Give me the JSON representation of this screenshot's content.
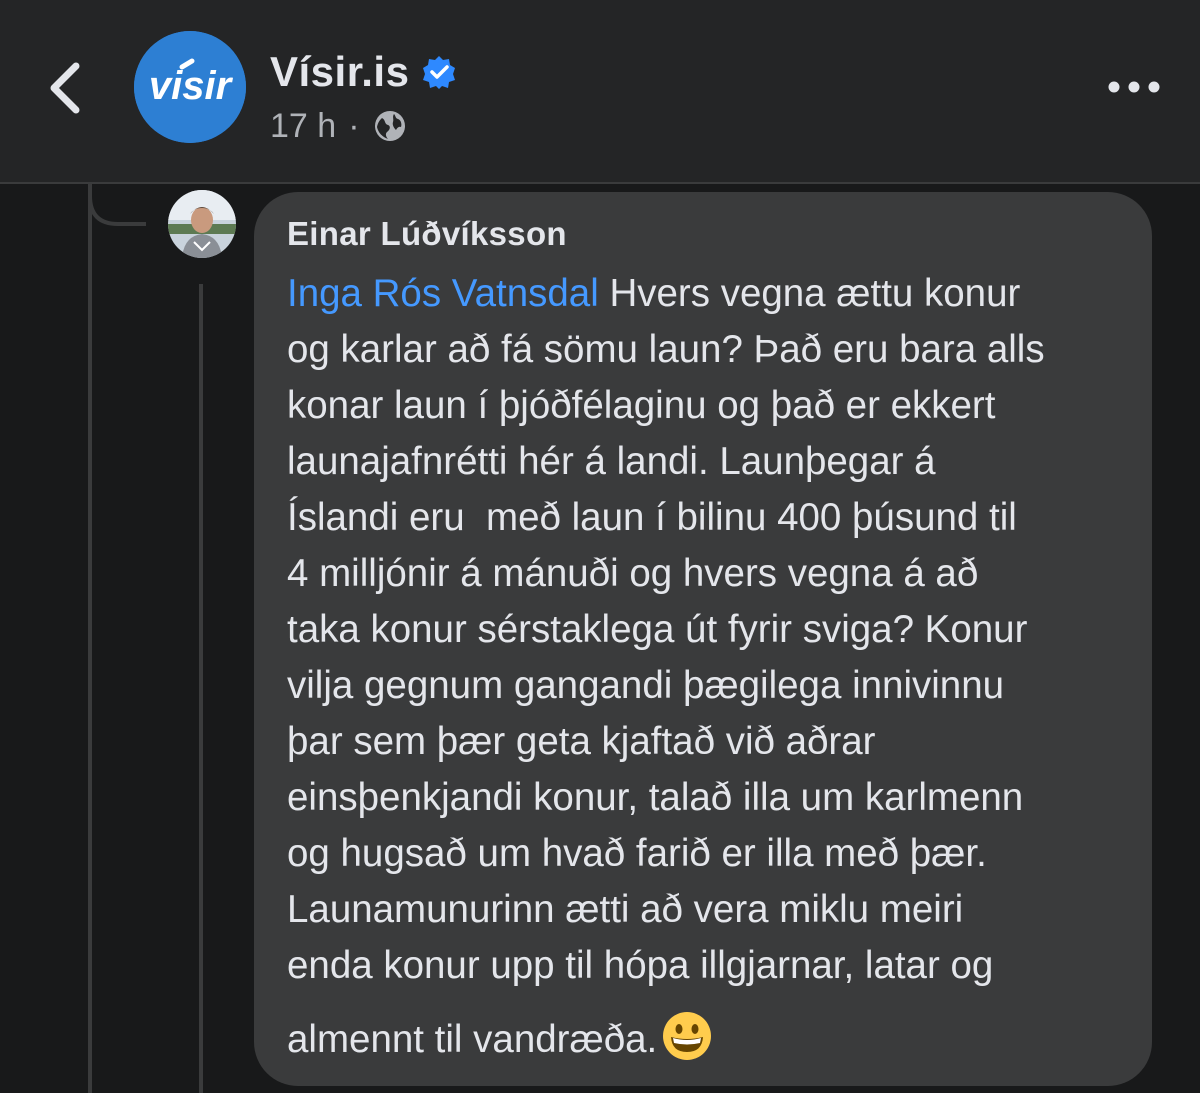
{
  "header": {
    "page_name": "Vísir.is",
    "page_avatar_text": "visir",
    "timestamp": "17 h",
    "separator": "·",
    "back_icon": "chevron-left-icon",
    "verified_icon": "verified-badge-icon",
    "privacy_icon": "globe-icon",
    "more_icon": "more-horizontal-icon"
  },
  "comment": {
    "author": "Einar Lúðvíksson",
    "mention": "Inga Rós Vatnsdal",
    "lines": [
      " Hvers vegna ættu konur",
      "og karlar að fá sömu laun? Það eru bara alls",
      "konar laun í þjóðfélaginu og það er ekkert",
      "launajafnrétti hér á landi. Launþegar á",
      "Íslandi eru  með laun í bilinu 400 þúsund til",
      "4 milljónir á mánuði og hvers vegna á að",
      "taka konur sérstaklega út fyrir sviga? Konur",
      "vilja gegnum gangandi þægilega innivinnu",
      "þar sem þær geta kjaftað við aðrar",
      "einsþenkjandi konur, talað illa um karlmenn",
      "og hugsað um hvað farið er illa með þær.",
      "Launamunurinn ætti að vera miklu meiri",
      "enda konur upp til hópa illgjarnar, latar og",
      "almennt til vandræða."
    ],
    "emoji": "grinning-face-emoji"
  },
  "colors": {
    "background": "#18191a",
    "header_bg": "#242526",
    "bubble_bg": "#3a3b3c",
    "mention": "#4599ff",
    "brand_blue": "#2d7fd3",
    "text": "#e4e6eb",
    "secondary_text": "#b0b3b8"
  }
}
